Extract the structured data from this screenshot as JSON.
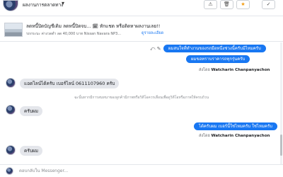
{
  "header": {
    "page_name": "ผลงานการตลาดทาง",
    "caret": "▾",
    "buttons": {
      "warn": "⚠",
      "trash": "🗑",
      "star": "★",
      "check": "✓"
    }
  },
  "item": {
    "title": "ลดหนี้ปิดบัญชีเดิม ลดหนี้ปิดจบ... 🗓 ทักแชต หรือติดหาผลงานเลย!!",
    "subtitle": "รถกระบะ ค่างวดต่ำ ลด 40,000 บาท Nissan Navara NP3...",
    "link": "ดูรายละเอียด"
  },
  "messages": {
    "out1": "ผมสนใจที่ทำงานของรถมือหนึ่งช่วงนี้ครับมีไหมครับ",
    "out2": "ผมขอทราบราคารถทุกรุ่นครับ",
    "sent_by_prefix": "ส่งโดย",
    "sent_by_name": "Watcharin Chanpanyachon",
    "in1": "แอดไลน์ได้ครับ เบอร์ไลน์ 0611107960  ครับ",
    "system_note": "ฉะนั้นหากมีการสนทนาของลูกค้ามีภาพหรือวิดีโอควรเลื่อนเพื่อดูวิดีโอหรือภาพให้ครบถ้วน",
    "in2": "ครับผม",
    "out3": "ได้ครับผม เบอร์นี้ใช่ไหมครับ ใช่ไหมครับ",
    "sent_by2_prefix": "ส่งโดย",
    "sent_by2_name": "Watcharin Chanpanyachon",
    "in3": "ครับผม",
    "tools": "⤺ ✎"
  },
  "composer": {
    "placeholder": "ตอบกลับใน Messenger..."
  },
  "colors": {
    "accent": "#1877f2",
    "incoming_bubble": "#e4e6eb",
    "star": "#f39c12"
  }
}
